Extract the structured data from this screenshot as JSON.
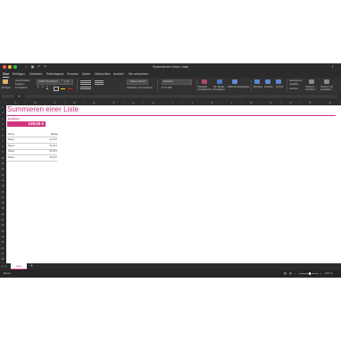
{
  "window": {
    "title": "Summieren einer Liste"
  },
  "menu": {
    "tabs": [
      "Start",
      "Einfügen",
      "Zeichnen",
      "Seitenlayout",
      "Formeln",
      "Daten",
      "Überprüfen",
      "Ansicht",
      "Sie wünschen"
    ],
    "active": "Start"
  },
  "ribbon": {
    "clipboard": {
      "paste": "Einfügen"
    },
    "cut": "Ausschneiden",
    "copy": "Kopieren",
    "format": "Formatieren",
    "font_name": "Calibri (Textkörper)",
    "font_size": "11",
    "wrap": "Zeilenumbruch",
    "merge": "Verbinden und zentrieren",
    "number_format": "Standard",
    "cond_format": "Bedingte Formatierung",
    "as_table": "Als Tabelle formatieren",
    "cell_styles": "Zellenformatvorlagen",
    "insert": "Einfügen",
    "delete": "Löschen",
    "format_cells": "Format",
    "autosum": "AutoSumme",
    "fill": "Ausfüllen",
    "clear": "Löschen",
    "sort": "Sortieren und filtern",
    "find": "Suchen und auswählen"
  },
  "columns": [
    "A",
    "B",
    "C",
    "D",
    "E",
    "F",
    "G",
    "H",
    "I",
    "J",
    "K",
    "L",
    "M",
    "N",
    "O",
    "P",
    "Q"
  ],
  "rows": [
    "1",
    "2",
    "3",
    "4",
    "5",
    "6",
    "7",
    "8",
    "9",
    "10",
    "11",
    "12",
    "13",
    "14",
    "15",
    "16",
    "17",
    "18",
    "19",
    "20",
    "21",
    "22",
    "23",
    "24",
    "25",
    "26",
    "27",
    "28"
  ],
  "sheet": {
    "title": "Summieren einer Liste",
    "sum_label": "Ergebnis",
    "sum_value": "139,00 €",
    "headers": [
      "Name",
      "Betrag"
    ],
    "rows": [
      {
        "name": "Name",
        "value": "12,00 €"
      },
      {
        "name": "Name",
        "value": "46,00 €"
      },
      {
        "name": "Name",
        "value": "35,00 €"
      },
      {
        "name": "Name",
        "value": "46,00 €"
      }
    ]
  },
  "tabs": {
    "sheet1": "Liste",
    "add": "+"
  },
  "status": {
    "left": "Bereit",
    "zoom": "100 %"
  },
  "colors": {
    "accent": "#c8307a",
    "dark": "#2b2b2b"
  }
}
